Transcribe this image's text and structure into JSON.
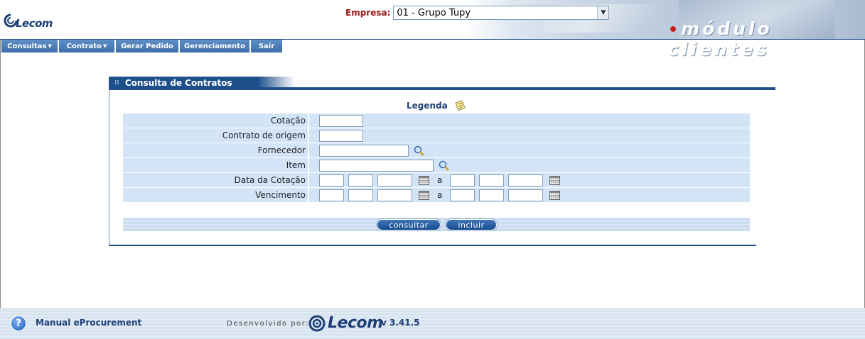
{
  "header": {
    "logo_text": "Lecom",
    "empresa_label": "Empresa:",
    "empresa_value": "01 - Grupo Tupy",
    "module_title": "módulo clientes"
  },
  "menu": [
    {
      "label": "Consultas",
      "has_dropdown": true
    },
    {
      "label": "Contrato",
      "has_dropdown": true
    },
    {
      "label": "Gerar Pedido",
      "has_dropdown": false
    },
    {
      "label": "Gerenciamento",
      "has_dropdown": false
    },
    {
      "label": "Sair",
      "has_dropdown": false
    }
  ],
  "panel": {
    "title": "Consulta de Contratos",
    "legenda_label": "Legenda",
    "fields": {
      "cotacao": "Cotação",
      "contrato_origem": "Contrato de origem",
      "fornecedor": "Fornecedor",
      "item": "Item",
      "data_cotacao": "Data da Cotação",
      "vencimento": "Vencimento"
    },
    "range_separator": "a",
    "buttons": {
      "consultar": "consultar",
      "incluir": "incluir"
    }
  },
  "footer": {
    "manual_label": "Manual eProcurement",
    "developed_by": "Desenvolvido por:",
    "logo_text": "Lecom",
    "version": "v 3.41.5"
  },
  "colors": {
    "brand_blue": "#1d4f8b",
    "row_bg": "#d3e4f7",
    "empresa_label": "#a0161a"
  }
}
